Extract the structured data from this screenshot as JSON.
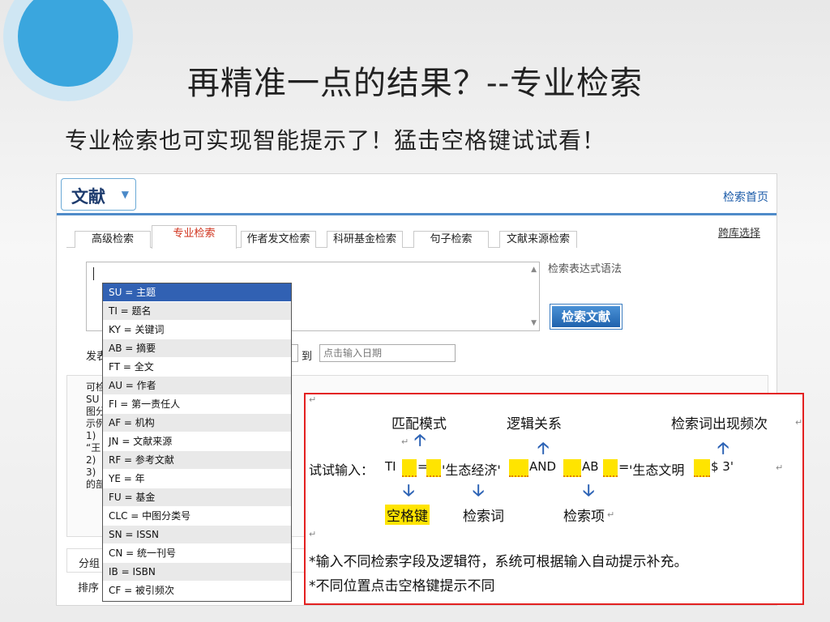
{
  "slide": {
    "title": "再精准一点的结果？--专业检索",
    "subtitle": "专业检索也可实现智能提示了！猛击空格键试试看！"
  },
  "header": {
    "brand_label": "文献",
    "home_link": "检索首页"
  },
  "tabs": [
    {
      "label": "高级检索"
    },
    {
      "label": "专业检索",
      "active": true
    },
    {
      "label": "作者发文检索"
    },
    {
      "label": "科研基金检索"
    },
    {
      "label": "句子检索"
    },
    {
      "label": "文献来源检索"
    }
  ],
  "cross_db_link": "跨库选择",
  "search": {
    "syntax_link": "检索表达式语法",
    "submit_label": "检索文献",
    "date_label": "发表",
    "date_to_label": "到",
    "date_placeholder": "点击输入日期"
  },
  "help_lines": [
    "可检",
    "SU",
    "图分",
    "示例",
    "1)",
    "“王",
    "2)",
    "3)",
    "的部"
  ],
  "bottom": {
    "group_label": "分组",
    "sort_label": "排序"
  },
  "field_dropdown": [
    "SU = 主题",
    "TI = 题名",
    "KY = 关键词",
    "AB = 摘要",
    "FT = 全文",
    "AU = 作者",
    "FI = 第一责任人",
    "AF = 机构",
    "JN = 文献来源",
    "RF = 参考文献",
    "YE = 年",
    "FU = 基金",
    "CLC = 中图分类号",
    "SN = ISSN",
    "CN = 统一刊号",
    "IB = ISBN",
    "CF = 被引频次"
  ],
  "selected_field": "SU = 主题",
  "tip": {
    "label_match": "匹配模式",
    "label_logic": "逻辑关系",
    "label_freq": "检索词出现频次",
    "try_label": "试试输入：",
    "seq_ti": "TI",
    "seq_eq1": "=",
    "seq_term1": "'生态经济'",
    "seq_and": "AND",
    "seq_ab": "AB",
    "seq_eq2": "=",
    "seq_term2": "'生态文明",
    "seq_freq": "$ 3'",
    "label_space": "空格键",
    "label_term": "检索词",
    "label_field": "检索项",
    "note1": "*输入不同检索字段及逻辑符，系统可根据输入自动提示补充。",
    "note2": "*不同位置点击空格键提示不同",
    "para_mark": "↵"
  }
}
